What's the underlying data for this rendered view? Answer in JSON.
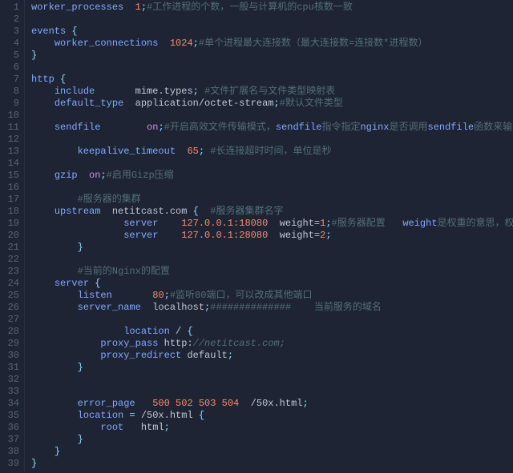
{
  "lines": [
    {
      "n": 1,
      "html": "<span class='dir'>worker_processes</span>  <span class='num'>1</span><span class='punc'>;</span><span class='cmt'>#工作进程的个数，一般与计算机的cpu核数一致</span>"
    },
    {
      "n": 2,
      "html": ""
    },
    {
      "n": 3,
      "html": "<span class='dir'>events</span> <span class='punc'>{</span>"
    },
    {
      "n": 4,
      "html": "    <span class='dir'>worker_connections</span>  <span class='num'>1024</span><span class='punc'>;</span><span class='cmt'>#单个进程最大连接数（最大连接数=连接数*进程数）</span>"
    },
    {
      "n": 5,
      "html": "<span class='punc'>}</span>"
    },
    {
      "n": 6,
      "html": ""
    },
    {
      "n": 7,
      "html": "<span class='dir'>http</span> <span class='punc'>{</span>"
    },
    {
      "n": 8,
      "html": "    <span class='dir'>include</span>       <span class='plain'>mime.types</span><span class='punc'>;</span> <span class='cmt'>#文件扩展名与文件类型映射表</span>"
    },
    {
      "n": 9,
      "html": "    <span class='dir'>default_type</span>  <span class='plain'>application/octet-stream</span><span class='punc'>;</span><span class='cmt'>#默认文件类型</span>"
    },
    {
      "n": 10,
      "html": ""
    },
    {
      "n": 11,
      "html": "    <span class='dir'>sendfile</span>        <span class='kw'>on</span><span class='punc'>;</span><span class='cmt'>#开启高效文件传输模式，</span><span class='hl'>sendfile</span><span class='cmt'>指令指定</span><span class='hl'>nginx</span><span class='cmt'>是否调用</span><span class='hl'>sendfile</span><span class='cmt'>函数来输出文件，对于普通应用设为 </span><span class='hl'>on</span><span class='cmt'>，如果</span>"
    },
    {
      "n": 12,
      "html": ""
    },
    {
      "n": 13,
      "html": "        <span class='dir'>keepalive_timeout</span>  <span class='num'>65</span><span class='punc'>;</span> <span class='cmt'>#长连接超时时间，单位是秒</span>"
    },
    {
      "n": 14,
      "html": ""
    },
    {
      "n": 15,
      "html": "    <span class='dir'>gzip</span>  <span class='kw'>on</span><span class='punc'>;</span><span class='cmt'>#启用Gizp压缩</span>"
    },
    {
      "n": 16,
      "html": ""
    },
    {
      "n": 17,
      "html": "        <span class='cmt'>#服务器的集群</span>"
    },
    {
      "n": 18,
      "html": "    <span class='dir'>upstream</span>  <span class='plain'>netitcast.com</span> <span class='punc'>{</span>  <span class='cmt'>#服务器集群名字</span>"
    },
    {
      "n": 19,
      "html": "                <span class='dir'>server</span>    <span class='num'>127.0.0.1:18080</span>  <span class='plain'>weight=</span><span class='num'>1</span><span class='punc'>;</span><span class='cmt'>#服务器配置   </span><span class='hl'>weight</span><span class='cmt'>是权重的意思，权重越大，分配的概率越大。</span>"
    },
    {
      "n": 20,
      "html": "                <span class='dir'>server</span>    <span class='num'>127.0.0.1:28080</span>  <span class='plain'>weight=</span><span class='num'>2</span><span class='punc'>;</span>"
    },
    {
      "n": 21,
      "html": "        <span class='punc'>}</span>"
    },
    {
      "n": 22,
      "html": ""
    },
    {
      "n": 23,
      "html": "        <span class='cmt'>#当前的Nginx的配置</span>"
    },
    {
      "n": 24,
      "html": "    <span class='dir'>server</span> <span class='punc'>{</span>"
    },
    {
      "n": 25,
      "html": "        <span class='dir'>listen</span>       <span class='num'>80</span><span class='punc'>;</span><span class='cmt'>#监听80端口，可以改成其他端口</span>"
    },
    {
      "n": 26,
      "html": "        <span class='dir'>server_name</span>  <span class='plain'>localhost</span><span class='punc'>;</span><span class='cmt'>##############    当前服务的域名</span>"
    },
    {
      "n": 27,
      "html": ""
    },
    {
      "n": 28,
      "html": "                <span class='dir'>location</span> <span class='plain'>/</span> <span class='punc'>{</span>"
    },
    {
      "n": 29,
      "html": "            <span class='dir'>proxy_pass</span> <span class='plain'>http:</span><span class='url'>//netitcast.com;</span>"
    },
    {
      "n": 30,
      "html": "            <span class='dir'>proxy_redirect</span> <span class='plain'>default</span><span class='punc'>;</span>"
    },
    {
      "n": 31,
      "html": "        <span class='punc'>}</span>"
    },
    {
      "n": 32,
      "html": ""
    },
    {
      "n": 33,
      "html": ""
    },
    {
      "n": 34,
      "html": "        <span class='dir'>error_page</span>   <span class='num'>500 502 503 504</span>  <span class='plain'>/50x.html</span><span class='punc'>;</span>"
    },
    {
      "n": 35,
      "html": "        <span class='dir'>location</span> <span class='punc'>=</span> <span class='plain'>/50x.html</span> <span class='punc'>{</span>"
    },
    {
      "n": 36,
      "html": "            <span class='dir'>root</span>   <span class='plain'>html</span><span class='punc'>;</span>"
    },
    {
      "n": 37,
      "html": "        <span class='punc'>}</span>"
    },
    {
      "n": 38,
      "html": "    <span class='punc'>}</span>"
    },
    {
      "n": 39,
      "html": "<span class='punc'>}</span>"
    }
  ],
  "config_data": {
    "worker_processes": 1,
    "events": {
      "worker_connections": 1024
    },
    "http": {
      "include": "mime.types",
      "default_type": "application/octet-stream",
      "sendfile": "on",
      "keepalive_timeout": 65,
      "gzip": "on",
      "upstream": {
        "name": "netitcast.com",
        "servers": [
          {
            "addr": "127.0.0.1:18080",
            "weight": 1
          },
          {
            "addr": "127.0.0.1:28080",
            "weight": 2
          }
        ]
      },
      "server": {
        "listen": 80,
        "server_name": "localhost",
        "location_root": {
          "proxy_pass": "http://netitcast.com",
          "proxy_redirect": "default"
        },
        "error_page": "500 502 503 504  /50x.html",
        "location_50x": {
          "root": "html"
        }
      }
    }
  }
}
